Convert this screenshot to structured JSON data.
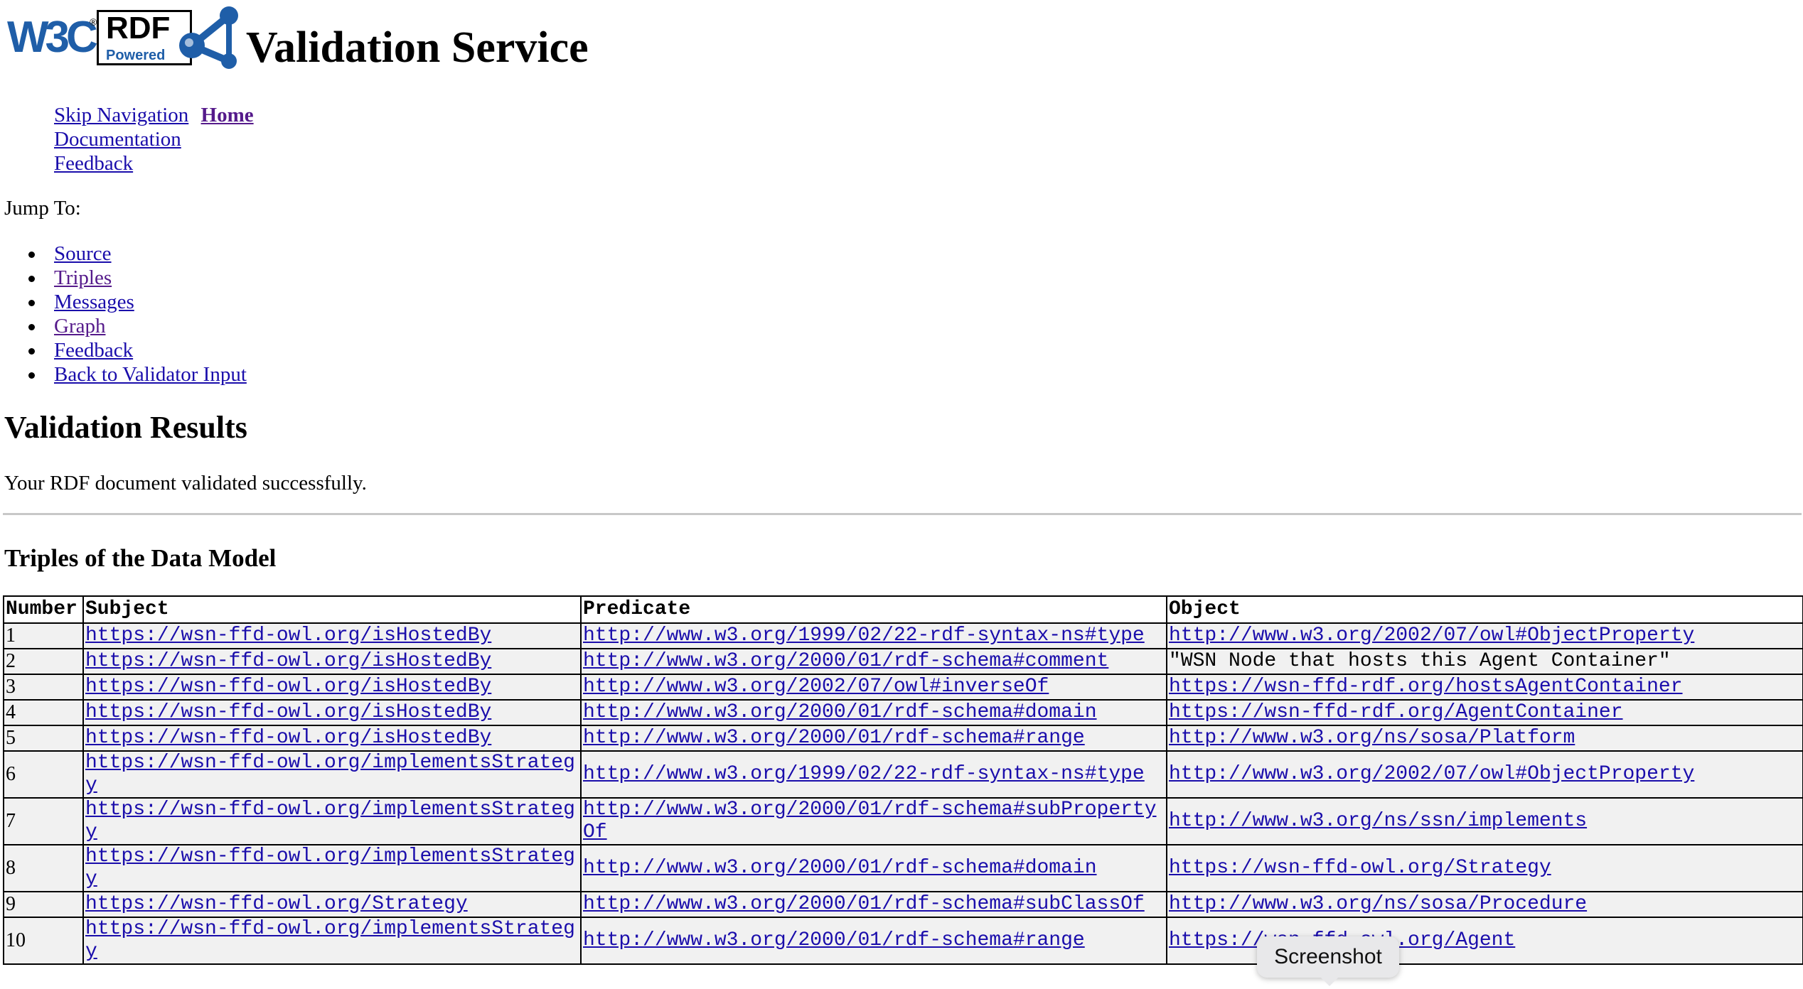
{
  "header": {
    "w3c_logo": "W3C",
    "rdf_badge": {
      "line1": "RDF",
      "line2": "Powered"
    },
    "title": "Validation Service"
  },
  "nav": {
    "skip": "Skip Navigation",
    "home": "Home",
    "documentation": "Documentation",
    "feedback": "Feedback"
  },
  "jump": {
    "label": "Jump To:",
    "items": [
      "Source",
      "Triples",
      "Messages",
      "Graph",
      "Feedback",
      "Back to Validator Input"
    ]
  },
  "results": {
    "heading": "Validation Results",
    "message": "Your RDF document validated successfully."
  },
  "triples": {
    "heading": "Triples of the Data Model",
    "columns": [
      "Number",
      "Subject",
      "Predicate",
      "Object"
    ],
    "rows": [
      [
        "1",
        "https://wsn-ffd-owl.org/isHostedBy",
        "http://www.w3.org/1999/02/22-rdf-syntax-ns#type",
        "http://www.w3.org/2002/07/owl#ObjectProperty"
      ],
      [
        "2",
        "https://wsn-ffd-owl.org/isHostedBy",
        "http://www.w3.org/2000/01/rdf-schema#comment",
        "\"WSN Node that hosts this Agent Container\""
      ],
      [
        "3",
        "https://wsn-ffd-owl.org/isHostedBy",
        "http://www.w3.org/2002/07/owl#inverseOf",
        "https://wsn-ffd-rdf.org/hostsAgentContainer"
      ],
      [
        "4",
        "https://wsn-ffd-owl.org/isHostedBy",
        "http://www.w3.org/2000/01/rdf-schema#domain",
        "https://wsn-ffd-rdf.org/AgentContainer"
      ],
      [
        "5",
        "https://wsn-ffd-owl.org/isHostedBy",
        "http://www.w3.org/2000/01/rdf-schema#range",
        "http://www.w3.org/ns/sosa/Platform"
      ],
      [
        "6",
        "https://wsn-ffd-owl.org/implementsStrategy",
        "http://www.w3.org/1999/02/22-rdf-syntax-ns#type",
        "http://www.w3.org/2002/07/owl#ObjectProperty"
      ],
      [
        "7",
        "https://wsn-ffd-owl.org/implementsStrategy",
        "http://www.w3.org/2000/01/rdf-schema#subPropertyOf",
        "http://www.w3.org/ns/ssn/implements"
      ],
      [
        "8",
        "https://wsn-ffd-owl.org/implementsStrategy",
        "http://www.w3.org/2000/01/rdf-schema#domain",
        "https://wsn-ffd-owl.org/Strategy"
      ],
      [
        "9",
        "https://wsn-ffd-owl.org/Strategy",
        "http://www.w3.org/2000/01/rdf-schema#subClassOf",
        "http://www.w3.org/ns/sosa/Procedure"
      ],
      [
        "10",
        "https://wsn-ffd-owl.org/implementsStrategy",
        "http://www.w3.org/2000/01/rdf-schema#range",
        "https://wsn-ffd-owl.org/Agent"
      ]
    ]
  },
  "tooltip": {
    "label": "Screenshot"
  },
  "colors": {
    "link": "#1a0dab",
    "visited": "#551a8b",
    "w3c_blue": "#1f5ea8",
    "row_bg": "#f1f1f1"
  }
}
